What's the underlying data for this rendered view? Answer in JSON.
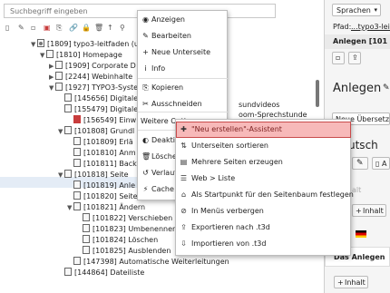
{
  "search": {
    "placeholder": "Suchbegriff eingeben"
  },
  "toolbar_icons": [
    "page-new-icon",
    "page-edit-icon",
    "page-view-icon",
    "page-delete-icon",
    "page-copy-icon",
    "link-icon",
    "lock-icon",
    "trash-icon",
    "up-icon",
    "filter-icon"
  ],
  "tree": [
    {
      "label": "[1809] typo3-leitfaden (u",
      "indent": 0,
      "icon": "site-root-icon",
      "toggle": "▼"
    },
    {
      "label": "[1810] Homepage",
      "indent": 1,
      "icon": "page-icon",
      "toggle": "▼"
    },
    {
      "label": "[1909] Corporate D",
      "indent": 2,
      "icon": "page-icon",
      "toggle": "▶"
    },
    {
      "label": "[2244] Webinhalte",
      "indent": 2,
      "icon": "page-icon",
      "toggle": "▶"
    },
    {
      "label": "[1927] TYPO3-Syste",
      "indent": 2,
      "icon": "page-icon",
      "toggle": "▼"
    },
    {
      "label": "[145656] Digitale",
      "indent": 3,
      "icon": "page-icon",
      "toggle": ""
    },
    {
      "label": "[155479] Digitale",
      "indent": 3,
      "icon": "page-icon",
      "toggle": ""
    },
    {
      "label": "[156549] Einw",
      "indent": 4,
      "icon": "page-restricted-icon",
      "toggle": ""
    },
    {
      "label": "[101808] Grundl",
      "indent": 3,
      "icon": "page-icon",
      "toggle": "▼"
    },
    {
      "label": "[101809] Erlä",
      "indent": 4,
      "icon": "page-icon",
      "toggle": ""
    },
    {
      "label": "[101810] Anm",
      "indent": 4,
      "icon": "page-icon",
      "toggle": ""
    },
    {
      "label": "[101811] Back",
      "indent": 4,
      "icon": "page-icon",
      "toggle": ""
    },
    {
      "label": "[101818] Seite",
      "indent": 3,
      "icon": "page-icon",
      "toggle": "▼"
    },
    {
      "label": "[101819] Anle",
      "indent": 4,
      "icon": "page-icon",
      "toggle": ""
    },
    {
      "label": "[101820] Seiteneigenscha",
      "indent": 4,
      "icon": "page-icon",
      "toggle": ""
    },
    {
      "label": "[101821] Ändern",
      "indent": 4,
      "icon": "page-icon",
      "toggle": "▼"
    },
    {
      "label": "[101822] Verschieben",
      "indent": 5,
      "icon": "page-icon",
      "toggle": ""
    },
    {
      "label": "[101823] Umbenennen",
      "indent": 5,
      "icon": "page-icon",
      "toggle": ""
    },
    {
      "label": "[101824] Löschen",
      "indent": 5,
      "icon": "page-icon",
      "toggle": ""
    },
    {
      "label": "[101825] Ausblenden",
      "indent": 5,
      "icon": "page-icon",
      "toggle": ""
    },
    {
      "label": "[147398] Automatische Weiterleitungen",
      "indent": 4,
      "icon": "page-icon",
      "toggle": ""
    },
    {
      "label": "[144864] Dateiliste",
      "indent": 3,
      "icon": "page-icon",
      "toggle": ""
    }
  ],
  "tree_overflow": {
    "row5": "sundvideos",
    "row6": "oom-Sprechstunde"
  },
  "context_menu": [
    {
      "label": "Anzeigen",
      "icon": "eye-icon",
      "glyph": "◉"
    },
    {
      "label": "Bearbeiten",
      "icon": "pencil-icon",
      "glyph": "✎"
    },
    {
      "label": "Neue Unterseite",
      "icon": "new-subpage-icon",
      "glyph": "+"
    },
    {
      "label": "Info",
      "icon": "info-icon",
      "glyph": "i"
    },
    {
      "label": "Kopieren",
      "icon": "copy-icon",
      "glyph": "⎘"
    },
    {
      "label": "Ausschneiden",
      "icon": "cut-icon",
      "glyph": "✂"
    },
    {
      "label": "Weitere Optionen",
      "icon": "",
      "glyph": "",
      "arrow": "▸"
    },
    {
      "label": "Deaktiv",
      "icon": "toggle-icon",
      "glyph": "◐"
    },
    {
      "label": "Löschen",
      "icon": "delete-icon",
      "glyph": "🗑"
    },
    {
      "label": "Verlauf/",
      "icon": "history-icon",
      "glyph": "↺"
    },
    {
      "label": "Cache c",
      "icon": "cache-icon",
      "glyph": "⚡"
    }
  ],
  "submenu": [
    {
      "label": "\"Neu erstellen\"-Assistent",
      "icon": "wizard-icon",
      "glyph": "✚",
      "highlight": true
    },
    {
      "label": "Unterseiten sortieren",
      "icon": "sort-icon",
      "glyph": "⇅"
    },
    {
      "label": "Mehrere Seiten erzeugen",
      "icon": "pages-icon",
      "glyph": "▤"
    },
    {
      "label": "Web > Liste",
      "icon": "list-icon",
      "glyph": "☰"
    },
    {
      "label": "Als Startpunkt für den Seitenbaum festlegen",
      "icon": "mountpoint-icon",
      "glyph": "⌂"
    },
    {
      "label": "In Menüs verbergen",
      "icon": "hide-icon",
      "glyph": "⊘"
    },
    {
      "label": "Exportieren nach .t3d",
      "icon": "export-icon",
      "glyph": "⇪"
    },
    {
      "label": "Importieren von .t3d",
      "icon": "import-icon",
      "glyph": "⇩"
    }
  ],
  "right_panel": {
    "language_select": "Sprachen",
    "path_label": "Pfad:",
    "path_value": "...typo3-leitfa",
    "tab_label": "Anlegen [101",
    "heading": "Anlegen",
    "subtitle_select": "Neue Übersetz",
    "lang_heading": "utsch",
    "insert_label": "Inhalt",
    "insert_label2": "Inhalt",
    "faded_text": "alt",
    "anlegen_label": "Das Anlegen"
  },
  "colors": {
    "highlight_bg": "#f7b9b9",
    "highlight_border": "#c74b4b",
    "tree_selected": "#e4ecf6"
  }
}
